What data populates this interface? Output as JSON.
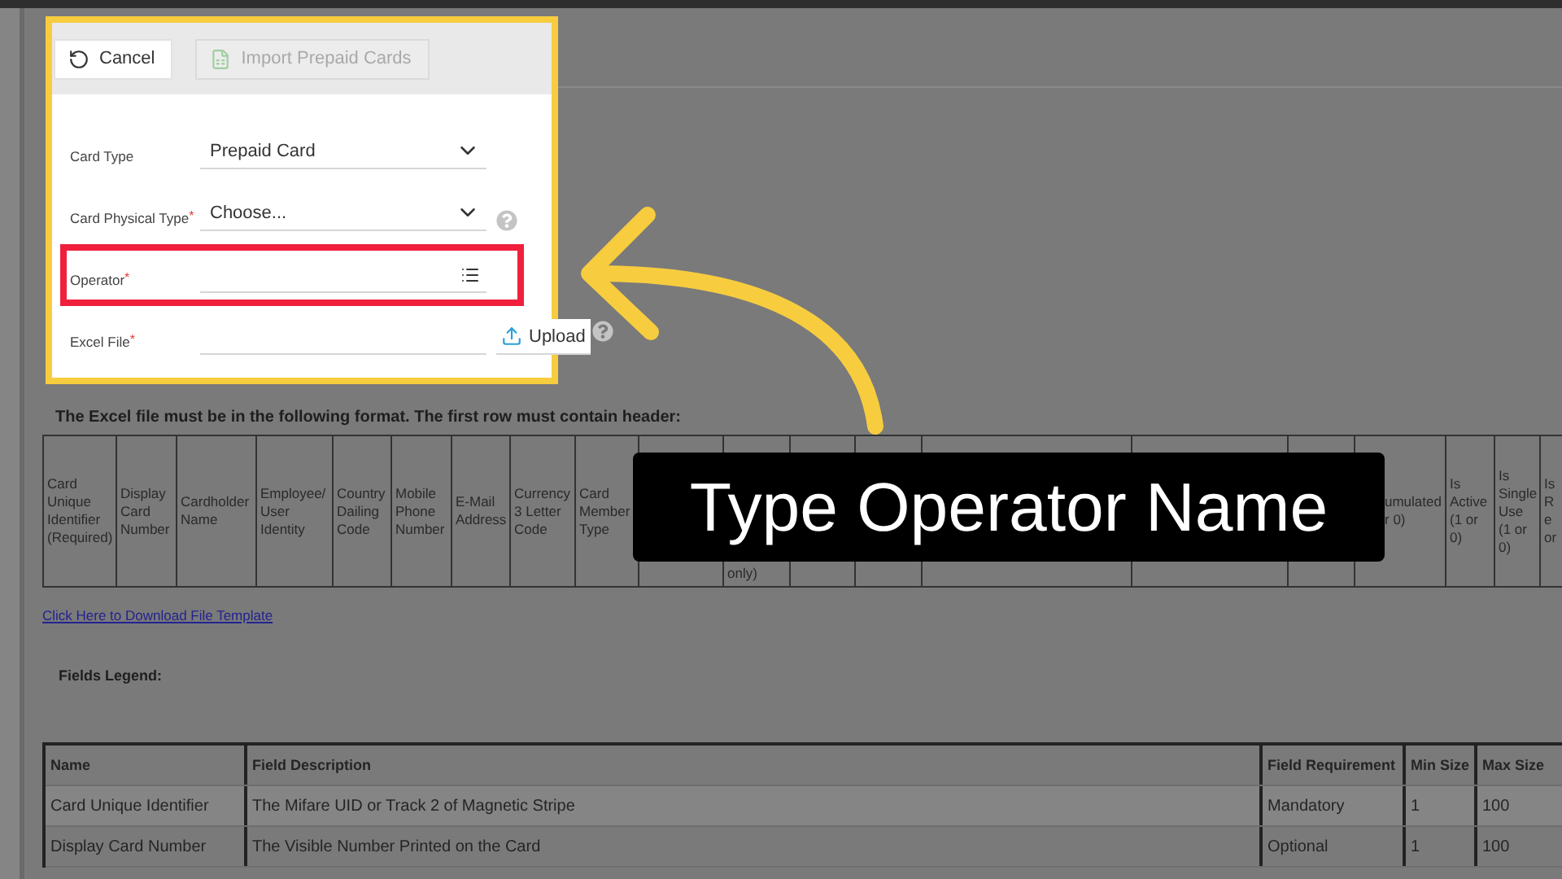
{
  "panel": {
    "toolbar": {
      "cancel": "Cancel",
      "import": {
        "label": "Import Prepaid Cards",
        "disabled": true
      }
    },
    "fields": [
      {
        "kind": "select",
        "label": "Card Type",
        "value": "Prepaid Card",
        "help": false,
        "highlighted": false
      },
      {
        "kind": "select",
        "label": "Card Physical Type",
        "required_mark": "*",
        "value": "Choose...",
        "help": true,
        "highlighted": false
      },
      {
        "kind": "lookup",
        "label": "Operator",
        "required_mark": "*",
        "help": false,
        "highlighted": true
      },
      {
        "kind": "file",
        "label": "Excel File",
        "required_mark": "*",
        "button": "Upload",
        "help": true,
        "highlighted": false
      }
    ]
  },
  "format": {
    "heading": "The Excel file must be in the following format. The first row must contain header:",
    "columns": [
      {
        "label": "Card Unique Identifier (Required)"
      },
      {
        "label": "Display Card Number"
      },
      {
        "label": "Cardholder Name"
      },
      {
        "label": "Employee/ User Identity"
      },
      {
        "label": "Country Dailing Code"
      },
      {
        "label": "Mobile Phone Number"
      },
      {
        "label": "E-Mail Address"
      },
      {
        "label": "Currency 3 Letter Code"
      },
      {
        "label": "Card Member Type"
      },
      {},
      {
        "label": "only)"
      },
      {},
      {},
      {},
      {},
      {},
      {
        "label": "umulated r 0)"
      },
      {
        "label": "Is Active (1 or 0)"
      },
      {
        "label": "Is Single Use (1 or 0)"
      },
      {
        "label": "Is Re or"
      }
    ],
    "link": "Click Here to Download File Template"
  },
  "legend": {
    "title": "Fields Legend:",
    "columns": [
      "Name",
      "Field Description",
      "Field Requirement",
      "Min Size",
      "Max Size"
    ],
    "rows": [
      [
        "Card Unique Identifier",
        "The Mifare UID or Track 2 of Magnetic Stripe",
        "Mandatory",
        "1",
        "100"
      ],
      [
        "Display Card Number",
        "The Visible Number Printed on the Card",
        "Optional",
        "1",
        "100"
      ]
    ]
  },
  "caption": "Type Operator Name"
}
